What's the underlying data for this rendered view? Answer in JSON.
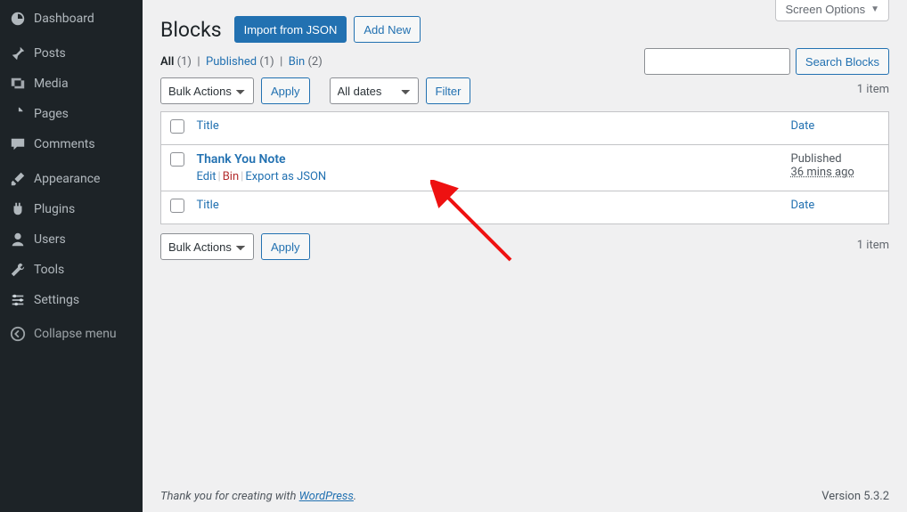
{
  "sidebar": {
    "items": [
      {
        "label": "Dashboard",
        "icon": "dashboard"
      },
      {
        "label": "Posts",
        "icon": "pin"
      },
      {
        "label": "Media",
        "icon": "media"
      },
      {
        "label": "Pages",
        "icon": "page"
      },
      {
        "label": "Comments",
        "icon": "comment"
      },
      {
        "label": "Appearance",
        "icon": "brush"
      },
      {
        "label": "Plugins",
        "icon": "plug"
      },
      {
        "label": "Users",
        "icon": "user"
      },
      {
        "label": "Tools",
        "icon": "wrench"
      },
      {
        "label": "Settings",
        "icon": "sliders"
      },
      {
        "label": "Collapse menu",
        "icon": "collapse"
      }
    ]
  },
  "screen_options_label": "Screen Options",
  "page": {
    "title": "Blocks",
    "import_btn": "Import from JSON",
    "add_new_btn": "Add New"
  },
  "filters": {
    "all_label": "All",
    "all_count": "(1)",
    "published_label": "Published",
    "published_count": "(1)",
    "bin_label": "Bin",
    "bin_count": "(2)"
  },
  "search": {
    "button": "Search Blocks"
  },
  "bulk": {
    "selected": "Bulk Actions",
    "apply": "Apply"
  },
  "datefilter": {
    "selected": "All dates",
    "filter": "Filter"
  },
  "count_label": "1 item",
  "columns": {
    "title": "Title",
    "date": "Date"
  },
  "rows": [
    {
      "title": "Thank You Note",
      "status": "Published",
      "time": "36 mins ago",
      "actions": {
        "edit": "Edit",
        "bin": "Bin",
        "export": "Export as JSON"
      }
    }
  ],
  "footer": {
    "thanks_pre": "Thank you for creating with ",
    "thanks_link": "WordPress",
    "thanks_post": ".",
    "version": "Version 5.3.2"
  }
}
